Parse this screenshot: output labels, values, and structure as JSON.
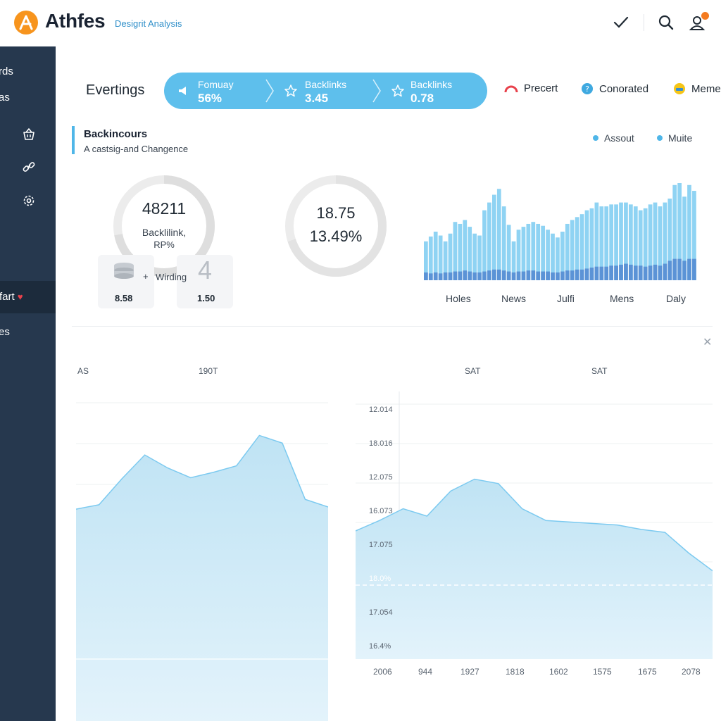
{
  "header": {
    "brand": "Athfes",
    "subtitle": "Desigrit Analysis",
    "icons": [
      "check-icon",
      "search-icon",
      "user-alert-icon"
    ],
    "accent": "#f7941d"
  },
  "sidebar": {
    "items": [
      {
        "label": "rds"
      },
      {
        "label": "as"
      },
      {
        "label": "fart"
      },
      {
        "label": "es"
      }
    ],
    "icons": [
      "basket-icon",
      "link-icon",
      "settings-icon"
    ],
    "background": "#26384e"
  },
  "metrics": {
    "title": "Evertings",
    "segments": [
      {
        "label": "Fomuay",
        "value": "56%"
      },
      {
        "label": "Backlinks",
        "value": "3.45"
      },
      {
        "label": "Backlinks",
        "value": "0.78"
      }
    ],
    "chips": [
      {
        "label": "Precert",
        "icon": "gauge-icon"
      },
      {
        "label": "Conorated",
        "icon": "help-icon"
      },
      {
        "label": "Meme",
        "icon": "emoji-icon"
      }
    ],
    "pill_color": "#5ebfec"
  },
  "stats": {
    "title": "Backincours",
    "subtitle": "A castsig-and Changence",
    "legend": [
      "Assout",
      "Muite"
    ],
    "ring1": {
      "value": "48211",
      "label": "Backlilink,",
      "sub": "RP%",
      "progress": 0.72
    },
    "ring2": {
      "value": "18.75",
      "sub": "13.49%",
      "progress": 0.7
    },
    "mini": {
      "label": "Wirding",
      "left_value": "8.58",
      "right_value": "1.50",
      "glyph": "4"
    },
    "bar_categories": [
      "Holes",
      "News",
      "Julfi",
      "Mens",
      "Daly"
    ]
  },
  "chart_data": [
    {
      "type": "bar",
      "title": "",
      "xlabel": "",
      "ylabel": "",
      "categories": [
        "Holes",
        "News",
        "Julfi",
        "Mens",
        "Daly"
      ],
      "series": [
        {
          "name": "Assout",
          "values": [
            40,
            45,
            50,
            46,
            40,
            48,
            60,
            58,
            62,
            55,
            48,
            46,
            72,
            80,
            88,
            94,
            76,
            57,
            40,
            52,
            55,
            58,
            60,
            58,
            56,
            52,
            48,
            44,
            50,
            58,
            62,
            65,
            68,
            72,
            74,
            80,
            76,
            76,
            78,
            78,
            80,
            80,
            78,
            76,
            72,
            74,
            78,
            80,
            76,
            80,
            84,
            98,
            100,
            86,
            98,
            92
          ]
        },
        {
          "name": "Muite",
          "values": [
            8,
            7,
            8,
            7,
            8,
            8,
            9,
            9,
            10,
            9,
            8,
            8,
            9,
            10,
            11,
            11,
            10,
            9,
            8,
            9,
            9,
            10,
            10,
            9,
            9,
            9,
            8,
            8,
            9,
            10,
            10,
            11,
            11,
            12,
            13,
            14,
            14,
            14,
            15,
            15,
            16,
            17,
            16,
            15,
            15,
            14,
            15,
            16,
            15,
            17,
            20,
            22,
            22,
            20,
            22,
            22
          ]
        }
      ],
      "ylim": [
        0,
        100
      ],
      "grid": false,
      "legend": "top-right"
    },
    {
      "type": "area",
      "title": "",
      "xlabel": "",
      "ylabel": "",
      "x_labels": [
        "AS",
        "190T"
      ],
      "series": [
        {
          "name": "",
          "values": [
            50,
            54,
            78,
            100,
            88,
            79,
            84,
            90,
            118,
            111,
            59,
            52
          ]
        }
      ],
      "ylim": [
        0,
        130
      ],
      "grid": true
    },
    {
      "type": "area",
      "title": "",
      "xlabel": "",
      "ylabel": "",
      "x_labels": [
        "SAT",
        "SAT"
      ],
      "y_ticks": [
        "12.014",
        "18.016",
        "12.075",
        "16.073",
        "17.075",
        "18.0%",
        "17.054",
        "16.4%"
      ],
      "categories": [
        "2006",
        "944",
        "1927",
        "1818",
        "1602",
        "1575",
        "1675",
        "2078"
      ],
      "series": [
        {
          "name": "",
          "values": [
            40,
            47,
            55,
            50,
            67,
            75,
            72,
            55,
            47,
            46,
            45,
            44,
            41,
            39,
            25,
            13
          ]
        }
      ],
      "reference_line": "18.0%",
      "ylim": [
        0,
        100
      ],
      "grid": true
    }
  ]
}
